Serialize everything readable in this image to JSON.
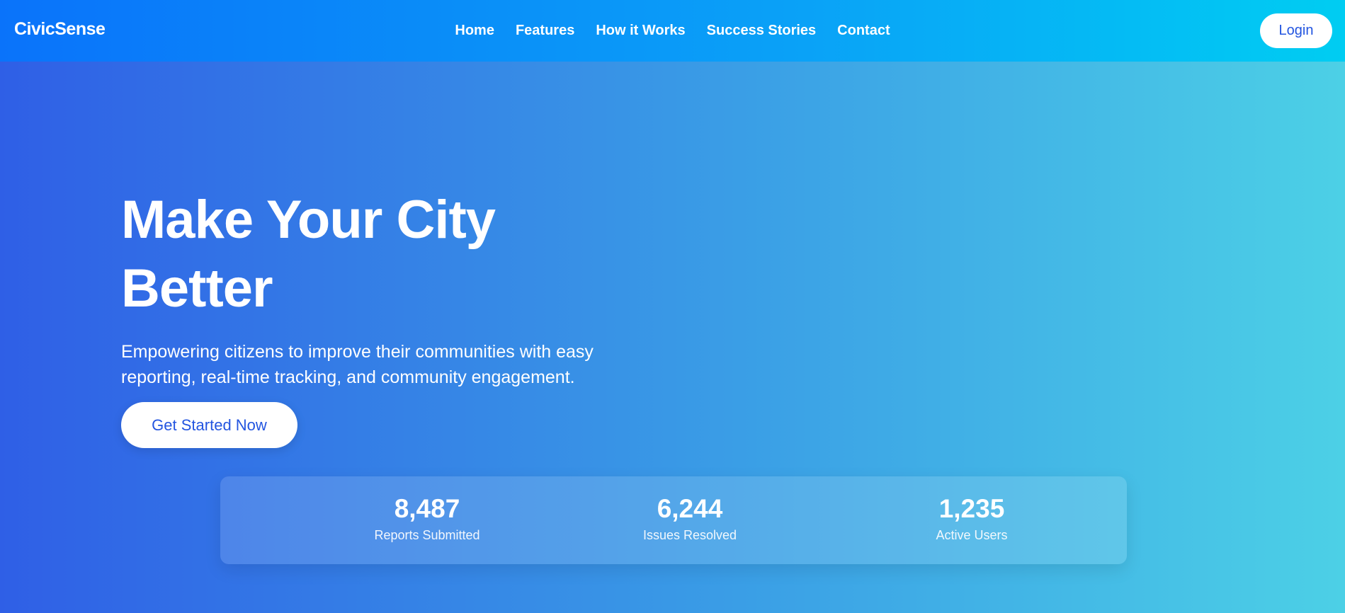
{
  "nav": {
    "brand": "CivicSense",
    "links": [
      "Home",
      "Features",
      "How it Works",
      "Success Stories",
      "Contact"
    ],
    "login_label": "Login"
  },
  "hero": {
    "title": "Make Your City Better",
    "subtitle": "Empowering citizens to improve their communities with easy reporting, real-time tracking, and community engagement.",
    "cta_label": "Get Started Now"
  },
  "stats": [
    {
      "value": "8,487",
      "label": "Reports Submitted"
    },
    {
      "value": "6,244",
      "label": "Issues Resolved"
    },
    {
      "value": "1,235",
      "label": "Active Users"
    }
  ],
  "colors": {
    "accent": "#2355e0",
    "nav_start": "#0a73fa",
    "nav_end": "#00cdf2",
    "hero_start": "#2f5fe6",
    "hero_end": "#4cd0e6"
  }
}
